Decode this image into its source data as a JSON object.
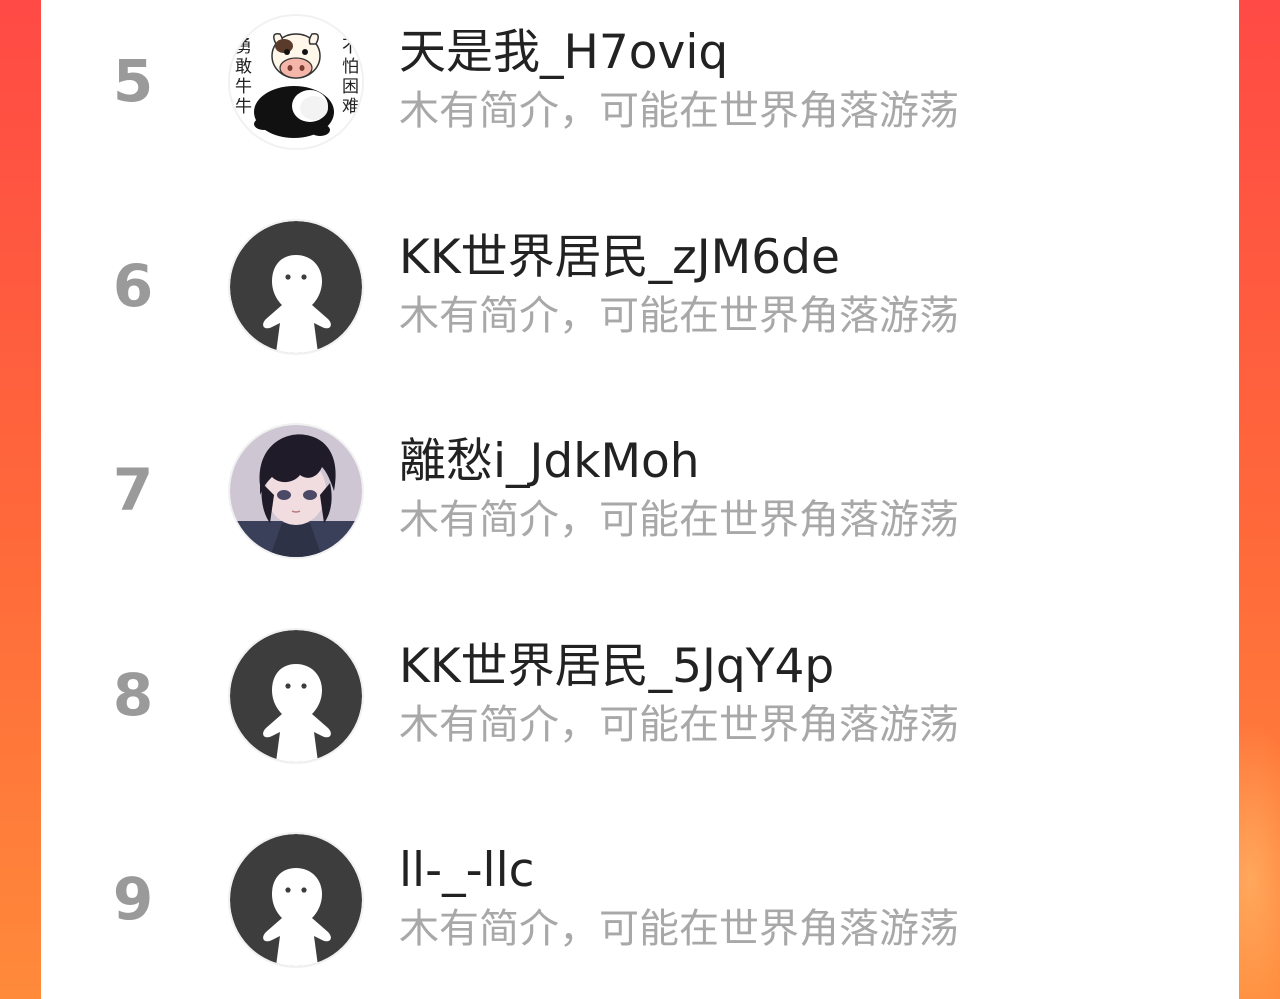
{
  "ranking_list": {
    "items": [
      {
        "rank": "5",
        "name": "天是我_H7oviq",
        "bio": "木有简介，可能在世界角落游荡",
        "avatar": "cow-sticker-avatar",
        "avatar_chars_left": "勇敢牛牛",
        "avatar_chars_right": "不怕困难"
      },
      {
        "rank": "6",
        "name": "KK世界居民_zJM6de",
        "bio": "木有简介，可能在世界角落游荡",
        "avatar": "default-ghost-avatar"
      },
      {
        "rank": "7",
        "name": "離愁i_JdkMoh",
        "bio": "木有简介，可能在世界角落游荡",
        "avatar": "anime-boy-avatar"
      },
      {
        "rank": "8",
        "name": "KK世界居民_5JqY4p",
        "bio": "木有简介，可能在世界角落游荡",
        "avatar": "default-ghost-avatar"
      },
      {
        "rank": "9",
        "name": "ll-_-llc",
        "bio": "木有简介，可能在世界角落游荡",
        "avatar": "default-ghost-avatar"
      }
    ]
  },
  "colors": {
    "background_gradient_top": "#ff4a45",
    "background_gradient_bottom": "#ff8a3a",
    "panel": "#ffffff",
    "rank_text": "#9a9a9a",
    "name_text": "#222222",
    "bio_text": "#a8a8a8",
    "default_avatar_bg": "#3d3d3d"
  }
}
